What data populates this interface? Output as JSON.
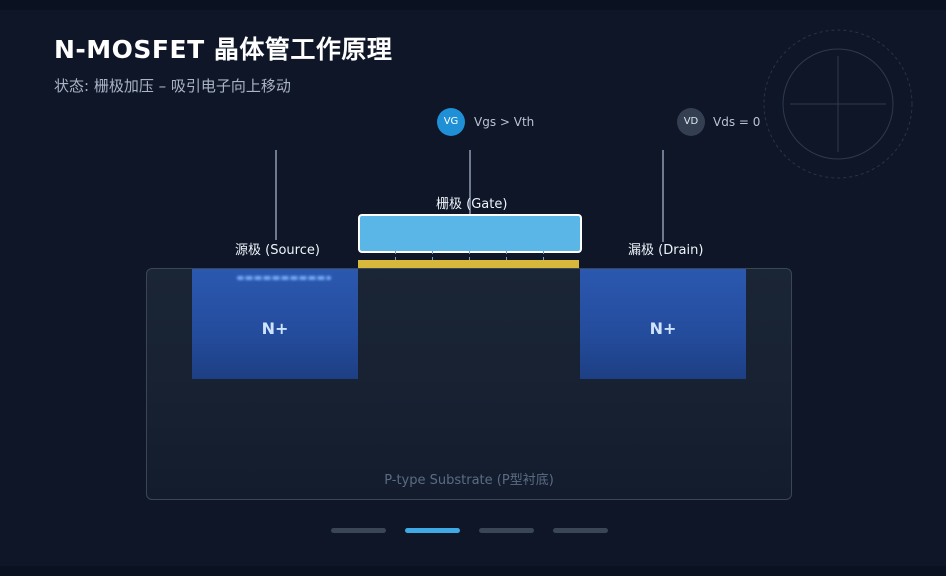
{
  "title": "N-MOSFET 晶体管工作原理",
  "subtitle": "状态: 栅极加压 – 吸引电子向上移动",
  "gate_badge": {
    "icon_text": "VG",
    "text": "Vgs > Vth"
  },
  "drain_badge": {
    "icon_text": "VD",
    "text": "Vds = 0"
  },
  "labels": {
    "gate": "栅极 (Gate)",
    "source": "源极 (Source)",
    "drain": "漏极 (Drain)"
  },
  "regions": {
    "source_region": "N+",
    "drain_region": "N+",
    "substrate": "P-type Substrate (P型衬底)"
  },
  "pagination": {
    "total": 4,
    "active_index": 1
  },
  "colors": {
    "background": "#0e1627",
    "gate": "#5ab6e6",
    "oxide": "#d8b83a",
    "n_region": "#2b58b0",
    "accent": "#3fa9e6"
  }
}
